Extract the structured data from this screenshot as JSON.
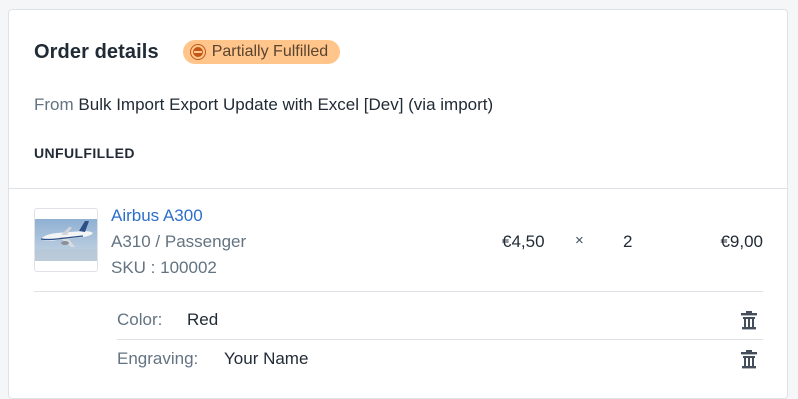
{
  "order": {
    "title": "Order details",
    "status_badge": "Partially Fulfilled",
    "source_prefix": "From",
    "source_name": "Bulk Import Export Update with Excel [Dev] (via import)",
    "section_label": "UNFULFILLED"
  },
  "line_item": {
    "name": "Airbus A300",
    "variant": "A310 / Passenger",
    "sku": "SKU : 100002",
    "price": "€4,50",
    "times": "×",
    "quantity": "2",
    "total": "€9,00",
    "properties": [
      {
        "key": "Color:",
        "value": "Red",
        "icon": "trash-icon"
      },
      {
        "key": "Engraving:",
        "value": "Your Name",
        "icon": "trash-icon"
      }
    ]
  },
  "colors": {
    "badge_bg": "#ffc58b",
    "badge_text": "#594430",
    "link": "#2c6ecb",
    "muted": "#637381"
  }
}
